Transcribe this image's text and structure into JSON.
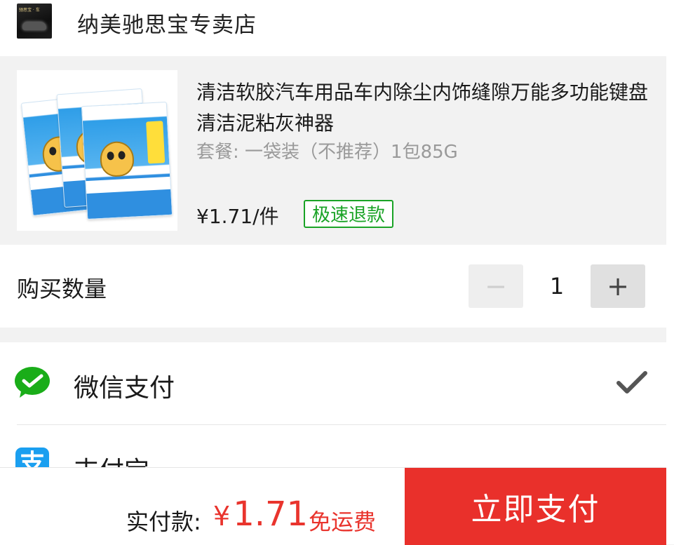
{
  "store": {
    "name": "纳美驰思宝专卖店",
    "logo_text": "驰思宝 · 车"
  },
  "product": {
    "title": "清洁软胶汽车用品车内除尘内饰缝隙万能多功能键盘清洁泥粘灰神器",
    "spec": "套餐: 一袋装（不推荐）1包85G",
    "price": "¥1.71/件",
    "refund_badge": "极速退款",
    "image_icon": "product-image"
  },
  "quantity": {
    "label": "购买数量",
    "value": "1",
    "minus": "−",
    "plus": "+"
  },
  "payment": {
    "options": [
      {
        "label": "微信支付",
        "icon": "wechat-pay-icon",
        "selected": true
      },
      {
        "label": "支付宝",
        "icon": "alipay-icon",
        "selected": false
      }
    ],
    "alipay_glyph": "支"
  },
  "footer": {
    "total_label": "实付款:",
    "currency": "¥",
    "amount": "1.71",
    "shipping": "免运费",
    "pay_button": "立即支付"
  },
  "colors": {
    "accent_red": "#e9302b",
    "price_red": "#e9342d",
    "refund_green": "#1aa326",
    "wechat_green": "#1aad19",
    "alipay_blue": "#1a9ff0"
  }
}
